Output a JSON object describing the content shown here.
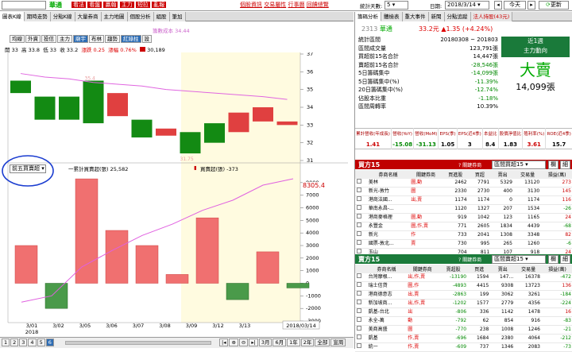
{
  "header": {
    "stock_input": "",
    "stock_name": "華通",
    "menu": [
      "看法",
      "看盤",
      "贏翰",
      "主力",
      "短拉",
      "亂報"
    ],
    "top_links": [
      "個股資訊",
      "交易屬性",
      "行事曆",
      "回饋總覽"
    ],
    "days_label": "統計天數:",
    "days_value": "5",
    "date_label": "日期:",
    "date_value": "2018/3/14",
    "today_label": "今天",
    "refresh_label": "更新"
  },
  "left_tabs": [
    "圖表K線",
    "期時走勢",
    "分點K線",
    "大量券商",
    "主力地圖",
    "個股分析",
    "組股",
    "筆加"
  ],
  "chart_toolbar": [
    "均線",
    "外資",
    "投信",
    "主力",
    "廟宇",
    "布林",
    "趨勢",
    "紅綠柱",
    "設"
  ],
  "ohlc": {
    "open_label": "開",
    "open": "33",
    "high_label": "高",
    "high": "33.8",
    "low_label": "低",
    "low": "33",
    "close_label": "收",
    "close": "33.2",
    "change_label": "漲跌",
    "change": "0.25",
    "pct_label": "漲幅",
    "pct": "0.76%",
    "vol": "30,189",
    "cost_label": "籌數成本 34.44"
  },
  "lower": {
    "select": "前五買賣超",
    "legend1": "一累計買賣超(張) 25,582",
    "legend2": "買賣超(張) -373",
    "last_value": "8305.4"
  },
  "chart_data": [
    {
      "type": "candlestick",
      "x": [
        "2/26",
        "2/27",
        "3/01",
        "3/02",
        "3/05",
        "3/06",
        "3/07",
        "3/08",
        "3/09",
        "3/12",
        "3/13",
        "3/14"
      ],
      "open": [
        35.5,
        34.6,
        34.6,
        35.5,
        33.5,
        33.3,
        32.4,
        32.6,
        33.1,
        32.6,
        33.2,
        33.0
      ],
      "close": [
        34.8,
        33.3,
        33.3,
        33.1,
        34.8,
        32.3,
        32.8,
        31.4,
        32.0,
        33.7,
        34.0,
        33.2
      ],
      "ylim": [
        31,
        37
      ],
      "yticks": [
        31,
        32,
        33,
        34,
        35,
        36,
        37
      ],
      "cost_line": [
        35.9,
        35.7,
        35.6,
        35.4,
        35.3,
        35.2,
        35.0,
        34.9,
        34.8,
        34.7,
        34.6,
        34.44
      ],
      "annot_high": "35.4",
      "annot_low": "31.75"
    },
    {
      "type": "bar+line",
      "x": [
        "3/01",
        "3/02",
        "3/05",
        "3/06",
        "3/07",
        "3/08",
        "3/09",
        "3/12",
        "3/13",
        "3/14"
      ],
      "bars": [
        3000,
        -2000,
        8300,
        4200,
        3000,
        700,
        5200,
        -1300,
        2500,
        -373
      ],
      "cumulative": [
        -1500,
        -1000,
        1300,
        2600,
        3800,
        4700,
        5800,
        6600,
        7800,
        8305.4
      ],
      "ylim": [
        -3000,
        9000
      ],
      "yticks": [
        -3000,
        -2000,
        -1000,
        0,
        1000,
        2000,
        3000,
        4000,
        5000,
        6000,
        7000,
        8000
      ]
    }
  ],
  "x_axis": {
    "labels": [
      "3/01",
      "3/02",
      "3/05",
      "3/06",
      "3/07",
      "3/08",
      "3/09",
      "3/12",
      "3/13"
    ],
    "year": "2018",
    "current": "2018/03/14"
  },
  "bottom": {
    "pages": [
      "1",
      "2",
      "3",
      "4",
      "5",
      "6"
    ],
    "ranges": [
      "3月",
      "6月",
      "1年",
      "2年",
      "全部",
      "宣周"
    ]
  },
  "right_tabs": [
    "籌碼分析",
    "體檢表",
    "重大事件",
    "新聞",
    "分點追蹤",
    "法人持股(43元)"
  ],
  "quote": {
    "code": "2313",
    "name": "華通",
    "price": "33.2元",
    "change": "▲1.35 (+4.24%)"
  },
  "stats": {
    "rows": [
      {
        "label": "統計區間",
        "value": "20180308 ~ 201803"
      },
      {
        "label": "區間成交量",
        "value": "123,791張"
      },
      {
        "label": "買超前15名合計",
        "value": "14,447張"
      },
      {
        "label": "賣超前15名合計",
        "value": "-28,546張"
      },
      {
        "label": "5日籌碼集中",
        "value": "-14,099張"
      },
      {
        "label": "5日籌碼集中(%)",
        "value": "-11.39%"
      },
      {
        "label": "20日籌碼集中(%)",
        "value": "-12.74%"
      },
      {
        "label": "佔股本比重",
        "value": "-1.18%"
      },
      {
        "label": "區間周轉率",
        "value": "10.39%"
      }
    ],
    "box_title": "近1週",
    "box_sub": "主力動向",
    "verdict": "大賣",
    "verdict_qty": "14,099張"
  },
  "indicators": {
    "headers": [
      "累計營收(年成長)",
      "營收(YoY)",
      "營收(MoM)",
      "EPS(季)",
      "EPS(近4季)",
      "本益比",
      "股價淨值比",
      "殖利率(%)",
      "ROE(近4季)"
    ],
    "values": [
      "1.41",
      "-15.08",
      "-31.13",
      "1.05",
      "3",
      "8.4",
      "1.83",
      "3.61",
      "15.7"
    ]
  },
  "buy": {
    "title": "買方15",
    "tag_label": "? 關鍵券商",
    "tag_value": "區間買超15",
    "btn1": "欄",
    "btn2": "細",
    "cols": [
      "券商名稱",
      "關鍵券商",
      "買進股",
      "買超",
      "賣出",
      "交易量",
      "損益(萬)"
    ],
    "rows": [
      [
        "美林",
        "圖,動",
        "2462",
        "7791",
        "5329",
        "13120",
        "273"
      ],
      [
        "新光-敦竹",
        "圖",
        "2330",
        "2730",
        "400",
        "3130",
        "145"
      ],
      [
        "港商法國...",
        "出,賣",
        "1174",
        "1174",
        "0",
        "1174",
        "116"
      ],
      [
        "華南永昌-...",
        "",
        "1120",
        "1327",
        "207",
        "1534",
        "-26"
      ],
      [
        "港商麥格理",
        "圖,動",
        "919",
        "1042",
        "123",
        "1165",
        "24"
      ],
      [
        "永豐金",
        "圖,作,賣",
        "771",
        "2605",
        "1834",
        "4439",
        "-68"
      ],
      [
        "新光",
        "作",
        "733",
        "2041",
        "1308",
        "3348",
        "82"
      ],
      [
        "國票-敦北...",
        "賣",
        "730",
        "995",
        "265",
        "1260",
        "-6"
      ],
      [
        "玉山",
        "",
        "704",
        "811",
        "107",
        "918",
        "24"
      ]
    ]
  },
  "sell": {
    "title": "賣方15",
    "tag_label": "? 關鍵券商",
    "tag_value": "區間賣超15",
    "btn1": "欄",
    "btn2": "細",
    "cols": [
      "券商名稱",
      "關鍵券商",
      "賣超股",
      "買進",
      "賣出",
      "交易量",
      "損益(萬)"
    ],
    "rows": [
      [
        "台灣摩根...",
        "出,作,賣",
        "-13190",
        "1594",
        "147...",
        "16378",
        "-472"
      ],
      [
        "瑞士信貸",
        "圖,作",
        "-4893",
        "4415",
        "9308",
        "13723",
        "136"
      ],
      [
        "港商德意志",
        "出,賣",
        "-2863",
        "199",
        "3062",
        "3261",
        "-184"
      ],
      [
        "新加坡商...",
        "出,作,賣",
        "-1202",
        "1577",
        "2779",
        "4356",
        "-224"
      ],
      [
        "凱基-台北",
        "出",
        "-806",
        "336",
        "1142",
        "1478",
        "16"
      ],
      [
        "永全-萬",
        "動",
        "-792",
        "62",
        "854",
        "916",
        "-83"
      ],
      [
        "美商高盛",
        "圖",
        "-770",
        "238",
        "1008",
        "1246",
        "-21"
      ],
      [
        "凱基",
        "作,賣",
        "-696",
        "1684",
        "2380",
        "4064",
        "-212"
      ],
      [
        "統一",
        "作,賣",
        "-609",
        "737",
        "1346",
        "2083",
        "-73"
      ]
    ]
  }
}
